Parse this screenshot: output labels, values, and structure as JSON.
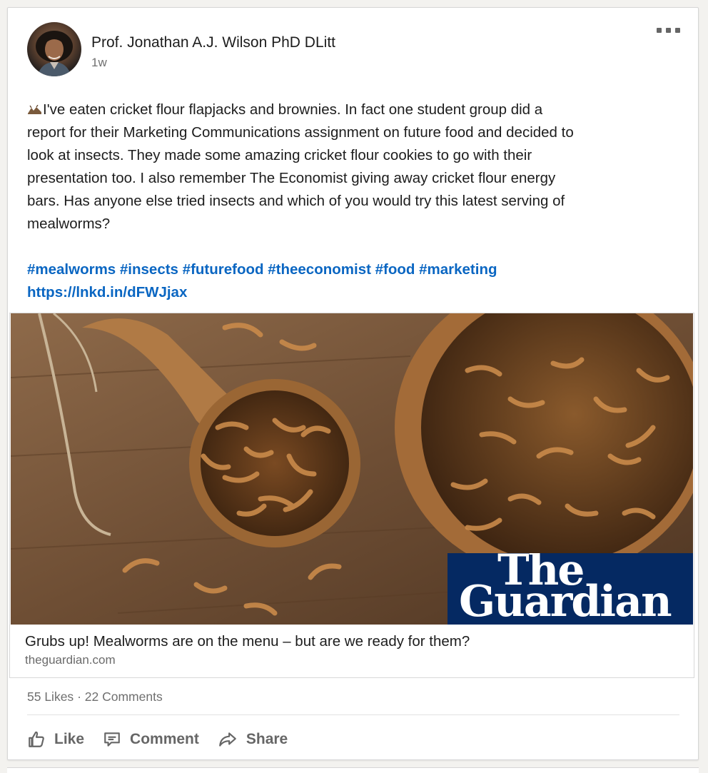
{
  "post": {
    "author": "Prof. Jonathan A.J. Wilson PhD DLitt",
    "time": "1w",
    "body": "I've eaten cricket flour flapjacks and brownies. In fact one student group did a\nreport for their Marketing Communications assignment on future food and decided to\nlook at insects. They made some amazing cricket flour cookies to go with their\npresentation too. I also remember The Economist giving away cricket flour energy\nbars. Has anyone else tried insects and which of you would try this latest serving of\nmealworms?",
    "hashtags": [
      "#mealworms",
      "#insects",
      "#futurefood",
      "#theeconomist",
      "#food",
      "#marketing"
    ],
    "link": "https://lnkd.in/dFWJjax"
  },
  "preview": {
    "logo_line1": "The",
    "logo_line2": "Guardian",
    "title": "Grubs up! Mealworms are on the menu – but are we ready for them?",
    "source": "theguardian.com"
  },
  "social": {
    "likes": "55 Likes",
    "separator": "·",
    "comments": "22 Comments"
  },
  "actions": {
    "like": "Like",
    "comment": "Comment",
    "share": "Share"
  },
  "colors": {
    "link": "#0a66c2",
    "guardian_blue": "#052962",
    "action_gray": "#666666"
  }
}
